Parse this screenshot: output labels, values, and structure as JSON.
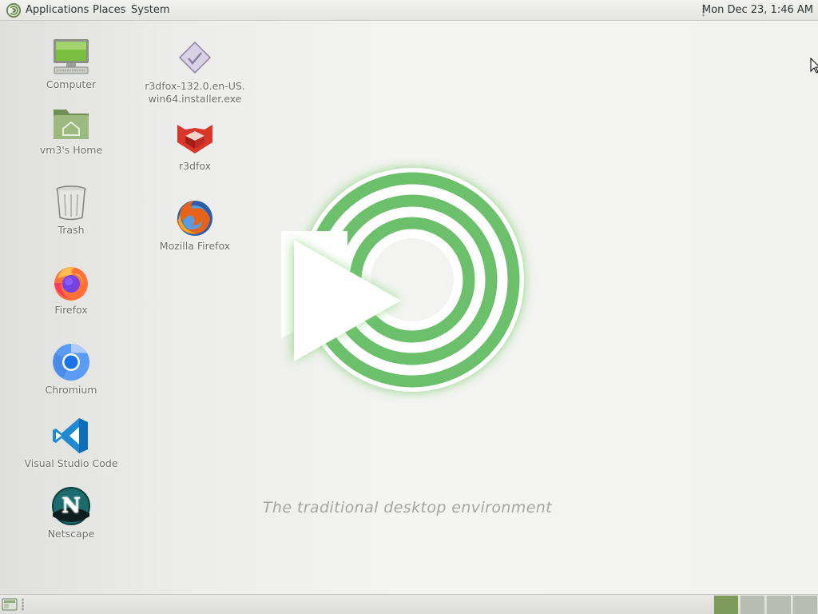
{
  "top_panel": {
    "menus": [
      "Applications",
      "Places",
      "System"
    ],
    "clock": "Mon Dec 23,  1:46 AM",
    "logo_icon": "mate-logo-icon"
  },
  "desktop": {
    "icons": [
      {
        "label": "Computer",
        "icon": "computer-icon"
      },
      {
        "label": "vm3's Home",
        "icon": "home-folder-icon"
      },
      {
        "label": "Trash",
        "icon": "trash-icon"
      },
      {
        "label": "Firefox",
        "icon": "firefox-icon"
      },
      {
        "label": "Chromium",
        "icon": "chromium-icon"
      },
      {
        "label": "Visual Studio Code",
        "icon": "vscode-icon"
      },
      {
        "label": "Netscape",
        "icon": "netscape-icon"
      },
      {
        "label": "r3dfox-132.0.en-US.\nwin64.installer.exe",
        "icon": "installer-file-icon"
      },
      {
        "label": "r3dfox",
        "icon": "r3dfox-icon"
      },
      {
        "label": "Mozilla Firefox",
        "icon": "mozilla-firefox-icon"
      }
    ]
  },
  "wallpaper": {
    "tagline": "The traditional desktop environment",
    "accent_color": "#6cc06c"
  },
  "bottom_panel": {
    "workspace_count": 4,
    "active_workspace": 1,
    "colors": {
      "active": "#7e9a5a",
      "inactive": "#b9bcb3"
    }
  }
}
